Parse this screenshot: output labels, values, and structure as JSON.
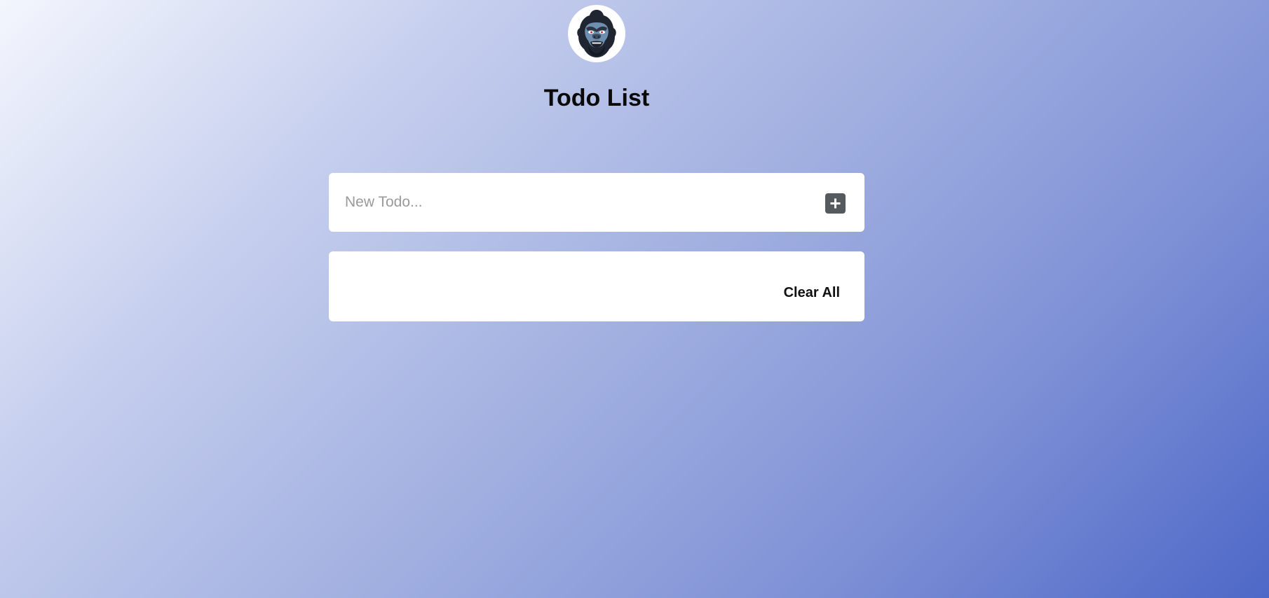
{
  "header": {
    "logo_icon": "gorilla-mascot-icon",
    "title": "Todo List"
  },
  "new_todo": {
    "placeholder": "New Todo...",
    "value": "",
    "add_icon": "plus-icon"
  },
  "todo_list": {
    "items": [],
    "clear_label": "Clear All"
  },
  "colors": {
    "gradient_start": "#f4f6fd",
    "gradient_end": "#4d68c7",
    "card": "#ffffff",
    "add_button": "#555a5e"
  }
}
